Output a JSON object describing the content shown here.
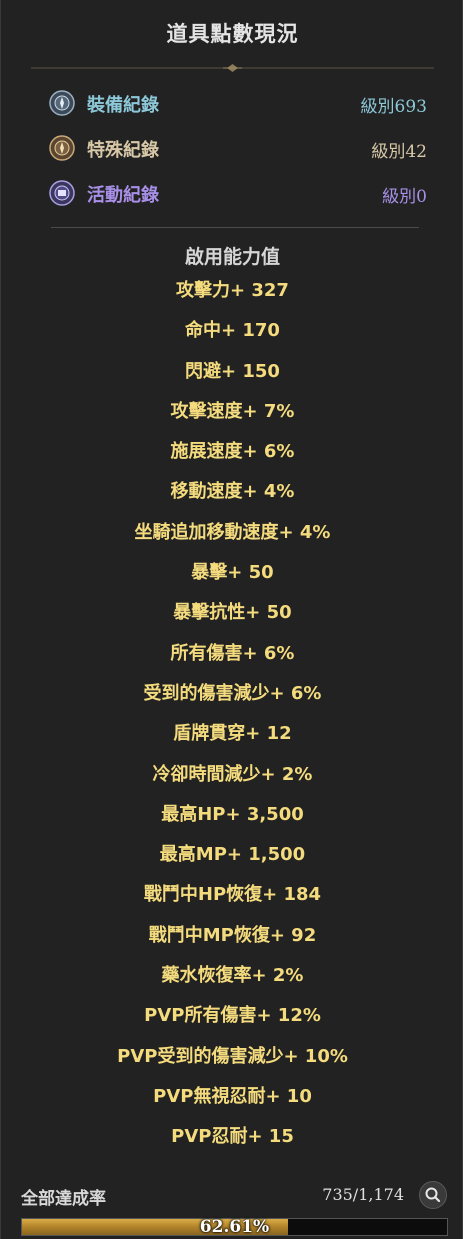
{
  "header": {
    "title": "道具點數現況"
  },
  "records": [
    {
      "name": "裝備紀錄",
      "level": "級別693",
      "color": "#8cc8d8",
      "icon": "equipment-record-icon"
    },
    {
      "name": "特殊紀錄",
      "level": "級別42",
      "color": "#d8c8a8",
      "icon": "special-record-icon"
    },
    {
      "name": "活動紀錄",
      "level": "級別0",
      "color": "#a890e8",
      "icon": "event-record-icon"
    }
  ],
  "abilities": {
    "title": "啟用能力值",
    "stats": [
      "攻擊力+ 327",
      "命中+ 170",
      "閃避+ 150",
      "攻擊速度+ 7%",
      "施展速度+ 6%",
      "移動速度+ 4%",
      "坐騎追加移動速度+ 4%",
      "暴擊+ 50",
      "暴擊抗性+ 50",
      "所有傷害+ 6%",
      "受到的傷害減少+ 6%",
      "盾牌貫穿+ 12",
      "冷卻時間減少+ 2%",
      "最高HP+ 3,500",
      "最高MP+ 1,500",
      "戰鬥中HP恢復+ 184",
      "戰鬥中MP恢復+ 92",
      "藥水恢復率+ 2%",
      "PVP所有傷害+ 12%",
      "PVP受到的傷害減少+ 10%",
      "PVP無視忍耐+ 10",
      "PVP忍耐+ 15"
    ]
  },
  "footer": {
    "label": "全部達成率",
    "count": "735/1,174",
    "progress_text": "62.61%",
    "progress_value": 0.6261,
    "search_icon": "search-icon"
  }
}
